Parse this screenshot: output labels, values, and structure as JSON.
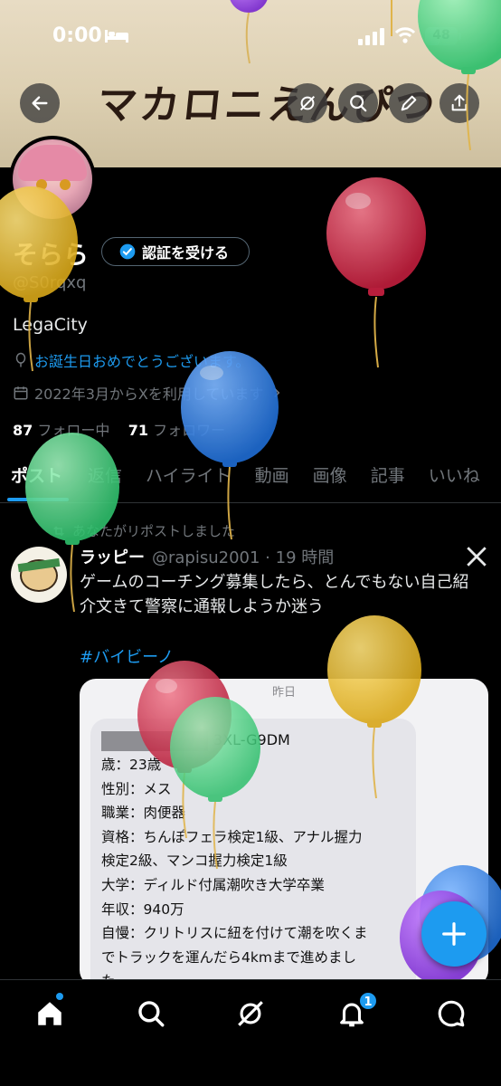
{
  "status": {
    "time": "0:00",
    "battery": "48",
    "battery_fraction": 0.48
  },
  "banner": {
    "logo_text": "マカロニえんぴつ"
  },
  "profile": {
    "display_name": "そらら",
    "verify_label": "認証を受ける",
    "handle": "@S0rqxq",
    "bio": "LegaCity",
    "birthday_text": "お誕生日おめでとうございます。",
    "joined_text": "2022年3月からXを利用しています",
    "following_count": "87",
    "following_label": "フォロー中",
    "followers_count": "71",
    "followers_label": "フォロワー"
  },
  "tabs": [
    "ポスト",
    "返信",
    "ハイライト",
    "動画",
    "画像",
    "記事",
    "いいね"
  ],
  "post": {
    "repost_label": "あなたがリポストしました",
    "author": "ラッピー",
    "handle_time": "@rapisu2001 · 19 時間",
    "text": "ゲームのコーチング募集したら、とんでもない自己紹介文きて警察に通報しようか迷う",
    "hashtag": "#バイビーノ",
    "card": {
      "date": "昨日",
      "id_suffix": "3XL-G9DM",
      "lines": [
        "歳：23歳",
        "性別：メス",
        "職業：肉便器",
        "資格：ちんぽフェラ検定1級、アナル握力",
        "検定2級、マンコ握力検定1級",
        "大学：ディルド付属潮吹き大学卒業",
        "年収：940万",
        "自慢：クリトリスに紐を付けて潮を吹くま",
        "でトラックを運んだら4kmまで進めまし",
        "た"
      ]
    }
  },
  "nav": {
    "items": [
      "home-icon",
      "search-icon",
      "grok-icon",
      "bell-icon",
      "messages-icon"
    ],
    "notification_badge": "1"
  },
  "colors": {
    "accent": "#1d9bf0",
    "background": "#000000",
    "muted": "#71767b"
  }
}
